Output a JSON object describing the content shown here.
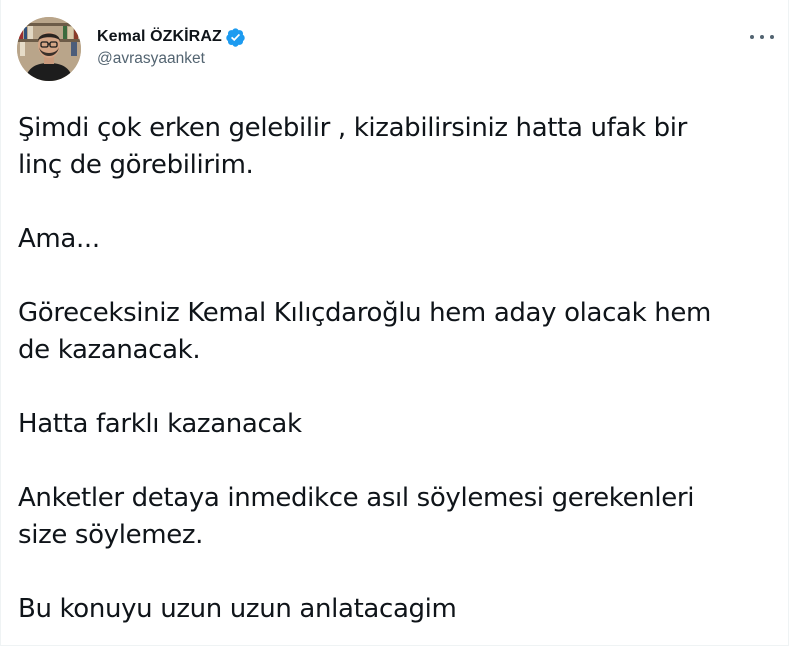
{
  "tweet": {
    "author": {
      "display_name": "Kemal ÖZKİRAZ",
      "handle": "@avrasyaanket",
      "verified": true,
      "avatar_icon": "profile-photo"
    },
    "more_icon": "more-horizontal-icon",
    "paragraphs": [
      "Şimdi çok erken gelebilir , kizabilirsiniz hatta ufak bir\nlinç de görebilirim.",
      "Ama...",
      "Göreceksiniz Kemal Kılıçdaroğlu hem aday olacak hem\nde kazanacak.",
      "Hatta farklı kazanacak",
      "Anketler detaya inmedikce asıl söylemesi gerekenleri\nsize söylemez.",
      "Bu konuyu uzun uzun anlatacagim"
    ]
  },
  "colors": {
    "text": "#0f1419",
    "secondary_text": "#536471",
    "verified_blue": "#1d9bf0",
    "background": "#ffffff"
  }
}
